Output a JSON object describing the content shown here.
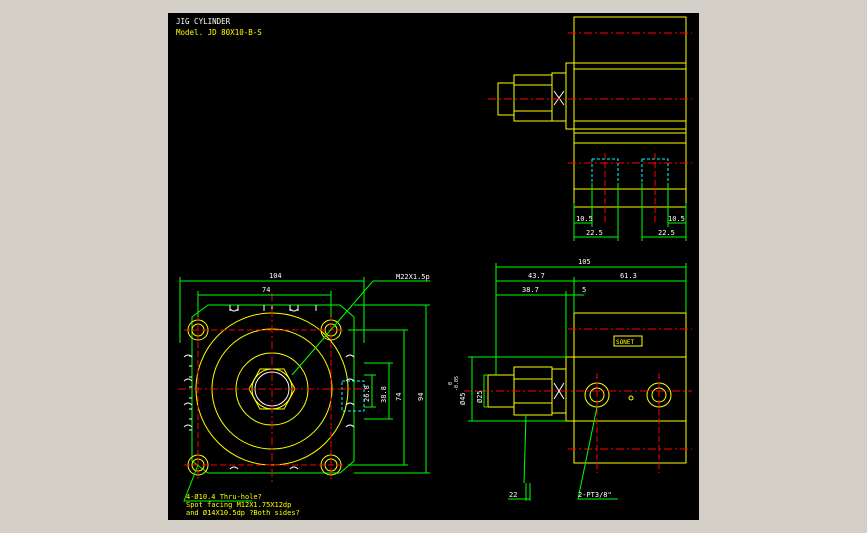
{
  "title": {
    "name": "JIG CYLINDER",
    "model": "Model. JD 80X10-B-S"
  },
  "dimensions": {
    "front_width_overall": "104",
    "front_width_holes": "74",
    "front_height_overall": "94",
    "front_height_holes": "74",
    "front_port_height_1": "38.8",
    "front_port_height_2": "26.8",
    "top_right_left_port": "10.5",
    "top_right_right_port": "10.5",
    "top_right_left_span": "22.5",
    "top_right_right_span": "22.5",
    "side_total_length": "105",
    "side_body_offset": "43.7",
    "side_body_length": "61.3",
    "side_rod_length": "38.7",
    "side_gap": "5",
    "side_rod_dia": "Ø25",
    "side_piston_dia": "Ø45",
    "side_bottom": "22"
  },
  "callouts": {
    "thread": "M22X1.5p",
    "mount_hole_1": "4-Ø10.4 Thru-hole?",
    "mount_hole_2": "Spot facing  M12X1.75X12dp",
    "mount_hole_3": "and Ø14X10.5dp ?Both sides?",
    "port": "2-PT3/8\"",
    "tol_plus": "0",
    "tol_minus": "-0.05",
    "nameplate": "SONET"
  },
  "colors": {
    "background": "#000000",
    "outline": "#ffff00",
    "dimension": "#00ff00",
    "centerline": "#ff0000",
    "hidden": "#00ffff",
    "text": "#ffffff",
    "frame": "#d4d0c8"
  }
}
